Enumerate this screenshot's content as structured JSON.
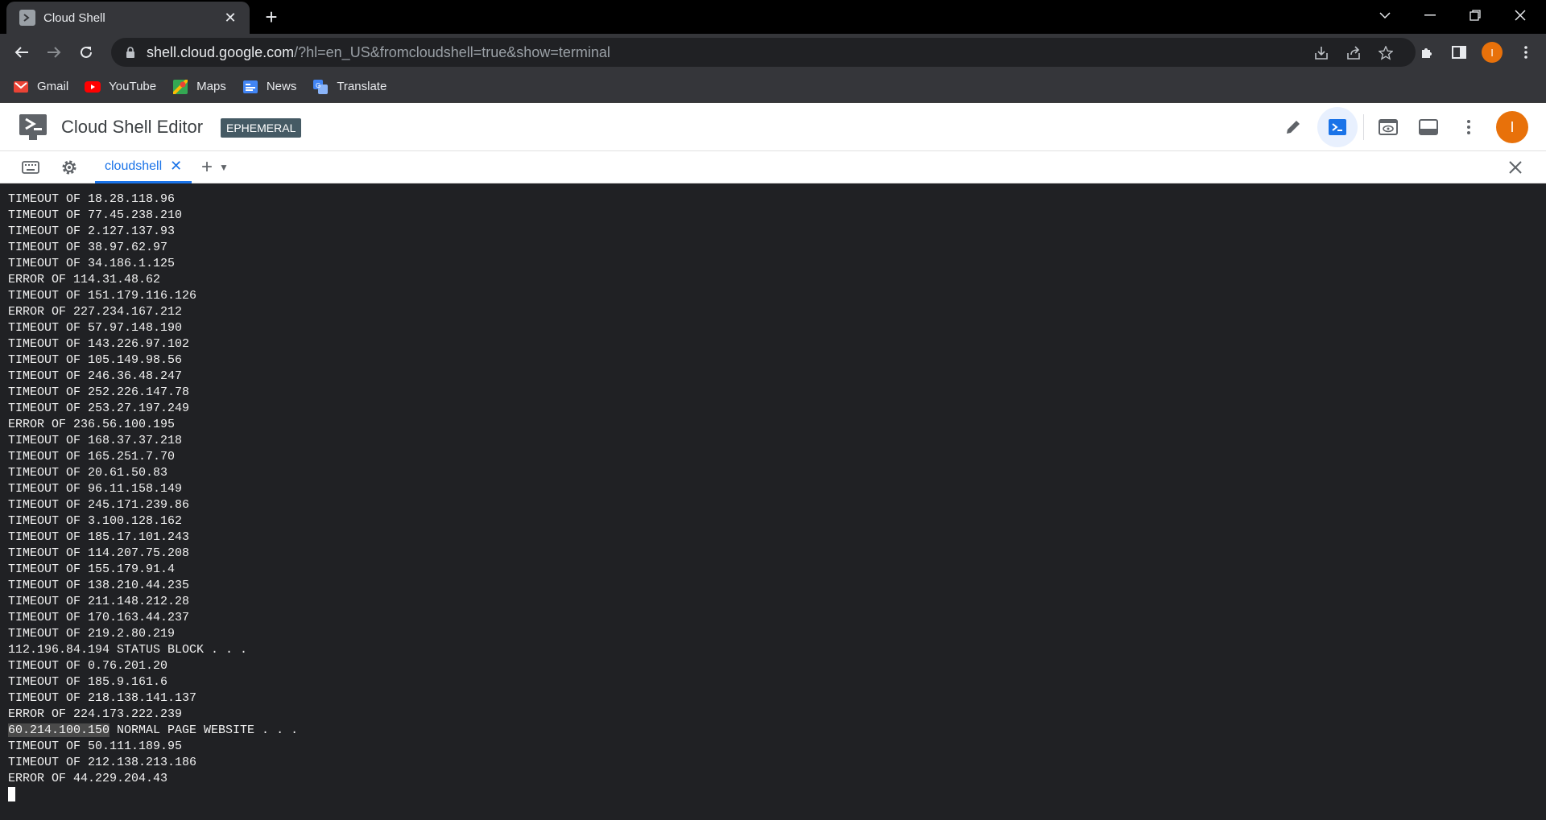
{
  "browser": {
    "tab_title": "Cloud Shell",
    "url_host": "shell.cloud.google.com",
    "url_path": "/?hl=en_US&fromcloudshell=true&show=terminal",
    "profile_initial": "I"
  },
  "bookmarks": [
    {
      "label": "Gmail",
      "icon": "gmail-icon"
    },
    {
      "label": "YouTube",
      "icon": "youtube-icon"
    },
    {
      "label": "Maps",
      "icon": "maps-icon"
    },
    {
      "label": "News",
      "icon": "news-icon"
    },
    {
      "label": "Translate",
      "icon": "translate-icon"
    }
  ],
  "app": {
    "title": "Cloud Shell Editor",
    "badge": "EPHEMERAL",
    "avatar_initial": "I"
  },
  "terminal_tabs": {
    "active_label": "cloudshell"
  },
  "terminal": {
    "lines": [
      "TIMEOUT OF 18.28.118.96",
      "TIMEOUT OF 77.45.238.210",
      "TIMEOUT OF 2.127.137.93",
      "TIMEOUT OF 38.97.62.97",
      "TIMEOUT OF 34.186.1.125",
      "ERROR OF 114.31.48.62",
      "TIMEOUT OF 151.179.116.126",
      "ERROR OF 227.234.167.212",
      "TIMEOUT OF 57.97.148.190",
      "TIMEOUT OF 143.226.97.102",
      "TIMEOUT OF 105.149.98.56",
      "TIMEOUT OF 246.36.48.247",
      "TIMEOUT OF 252.226.147.78",
      "TIMEOUT OF 253.27.197.249",
      "ERROR OF 236.56.100.195",
      "TIMEOUT OF 168.37.37.218",
      "TIMEOUT OF 165.251.7.70",
      "TIMEOUT OF 20.61.50.83",
      "TIMEOUT OF 96.11.158.149",
      "TIMEOUT OF 245.171.239.86",
      "TIMEOUT OF 3.100.128.162",
      "TIMEOUT OF 185.17.101.243",
      "TIMEOUT OF 114.207.75.208",
      "TIMEOUT OF 155.179.91.4",
      "TIMEOUT OF 138.210.44.235",
      "TIMEOUT OF 211.148.212.28",
      "TIMEOUT OF 170.163.44.237",
      "TIMEOUT OF 219.2.80.219",
      "112.196.84.194 STATUS BLOCK . . .",
      "TIMEOUT OF 0.76.201.20",
      "TIMEOUT OF 185.9.161.6",
      "TIMEOUT OF 218.138.141.137",
      "ERROR OF 224.173.222.239"
    ],
    "selected_line": {
      "selected": "60.214.100.150",
      "rest": " NORMAL PAGE WEBSITE . . ."
    },
    "lines_after": [
      "TIMEOUT OF 50.111.189.95",
      "TIMEOUT OF 212.138.213.186",
      "ERROR OF 44.229.204.43"
    ]
  }
}
